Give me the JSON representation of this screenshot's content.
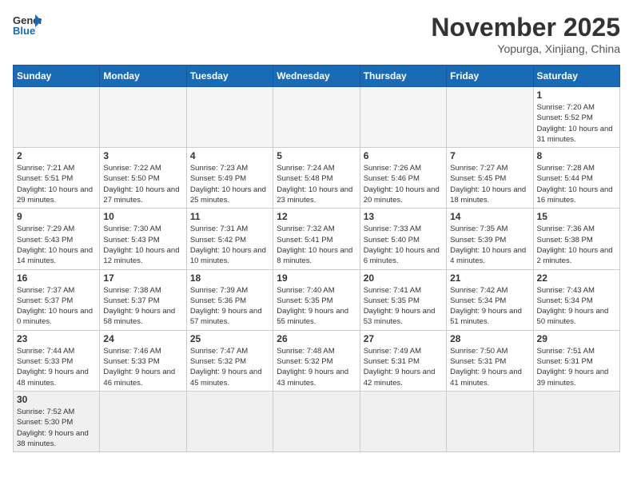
{
  "header": {
    "logo_general": "General",
    "logo_blue": "Blue",
    "month_title": "November 2025",
    "location": "Yopurga, Xinjiang, China"
  },
  "columns": [
    "Sunday",
    "Monday",
    "Tuesday",
    "Wednesday",
    "Thursday",
    "Friday",
    "Saturday"
  ],
  "days": {
    "1": {
      "sunrise": "7:20 AM",
      "sunset": "5:52 PM",
      "daylight": "10 hours and 31 minutes."
    },
    "2": {
      "sunrise": "7:21 AM",
      "sunset": "5:51 PM",
      "daylight": "10 hours and 29 minutes."
    },
    "3": {
      "sunrise": "7:22 AM",
      "sunset": "5:50 PM",
      "daylight": "10 hours and 27 minutes."
    },
    "4": {
      "sunrise": "7:23 AM",
      "sunset": "5:49 PM",
      "daylight": "10 hours and 25 minutes."
    },
    "5": {
      "sunrise": "7:24 AM",
      "sunset": "5:48 PM",
      "daylight": "10 hours and 23 minutes."
    },
    "6": {
      "sunrise": "7:26 AM",
      "sunset": "5:46 PM",
      "daylight": "10 hours and 20 minutes."
    },
    "7": {
      "sunrise": "7:27 AM",
      "sunset": "5:45 PM",
      "daylight": "10 hours and 18 minutes."
    },
    "8": {
      "sunrise": "7:28 AM",
      "sunset": "5:44 PM",
      "daylight": "10 hours and 16 minutes."
    },
    "9": {
      "sunrise": "7:29 AM",
      "sunset": "5:43 PM",
      "daylight": "10 hours and 14 minutes."
    },
    "10": {
      "sunrise": "7:30 AM",
      "sunset": "5:43 PM",
      "daylight": "10 hours and 12 minutes."
    },
    "11": {
      "sunrise": "7:31 AM",
      "sunset": "5:42 PM",
      "daylight": "10 hours and 10 minutes."
    },
    "12": {
      "sunrise": "7:32 AM",
      "sunset": "5:41 PM",
      "daylight": "10 hours and 8 minutes."
    },
    "13": {
      "sunrise": "7:33 AM",
      "sunset": "5:40 PM",
      "daylight": "10 hours and 6 minutes."
    },
    "14": {
      "sunrise": "7:35 AM",
      "sunset": "5:39 PM",
      "daylight": "10 hours and 4 minutes."
    },
    "15": {
      "sunrise": "7:36 AM",
      "sunset": "5:38 PM",
      "daylight": "10 hours and 2 minutes."
    },
    "16": {
      "sunrise": "7:37 AM",
      "sunset": "5:37 PM",
      "daylight": "10 hours and 0 minutes."
    },
    "17": {
      "sunrise": "7:38 AM",
      "sunset": "5:37 PM",
      "daylight": "9 hours and 58 minutes."
    },
    "18": {
      "sunrise": "7:39 AM",
      "sunset": "5:36 PM",
      "daylight": "9 hours and 57 minutes."
    },
    "19": {
      "sunrise": "7:40 AM",
      "sunset": "5:35 PM",
      "daylight": "9 hours and 55 minutes."
    },
    "20": {
      "sunrise": "7:41 AM",
      "sunset": "5:35 PM",
      "daylight": "9 hours and 53 minutes."
    },
    "21": {
      "sunrise": "7:42 AM",
      "sunset": "5:34 PM",
      "daylight": "9 hours and 51 minutes."
    },
    "22": {
      "sunrise": "7:43 AM",
      "sunset": "5:34 PM",
      "daylight": "9 hours and 50 minutes."
    },
    "23": {
      "sunrise": "7:44 AM",
      "sunset": "5:33 PM",
      "daylight": "9 hours and 48 minutes."
    },
    "24": {
      "sunrise": "7:46 AM",
      "sunset": "5:33 PM",
      "daylight": "9 hours and 46 minutes."
    },
    "25": {
      "sunrise": "7:47 AM",
      "sunset": "5:32 PM",
      "daylight": "9 hours and 45 minutes."
    },
    "26": {
      "sunrise": "7:48 AM",
      "sunset": "5:32 PM",
      "daylight": "9 hours and 43 minutes."
    },
    "27": {
      "sunrise": "7:49 AM",
      "sunset": "5:31 PM",
      "daylight": "9 hours and 42 minutes."
    },
    "28": {
      "sunrise": "7:50 AM",
      "sunset": "5:31 PM",
      "daylight": "9 hours and 41 minutes."
    },
    "29": {
      "sunrise": "7:51 AM",
      "sunset": "5:31 PM",
      "daylight": "9 hours and 39 minutes."
    },
    "30": {
      "sunrise": "7:52 AM",
      "sunset": "5:30 PM",
      "daylight": "9 hours and 38 minutes."
    }
  }
}
